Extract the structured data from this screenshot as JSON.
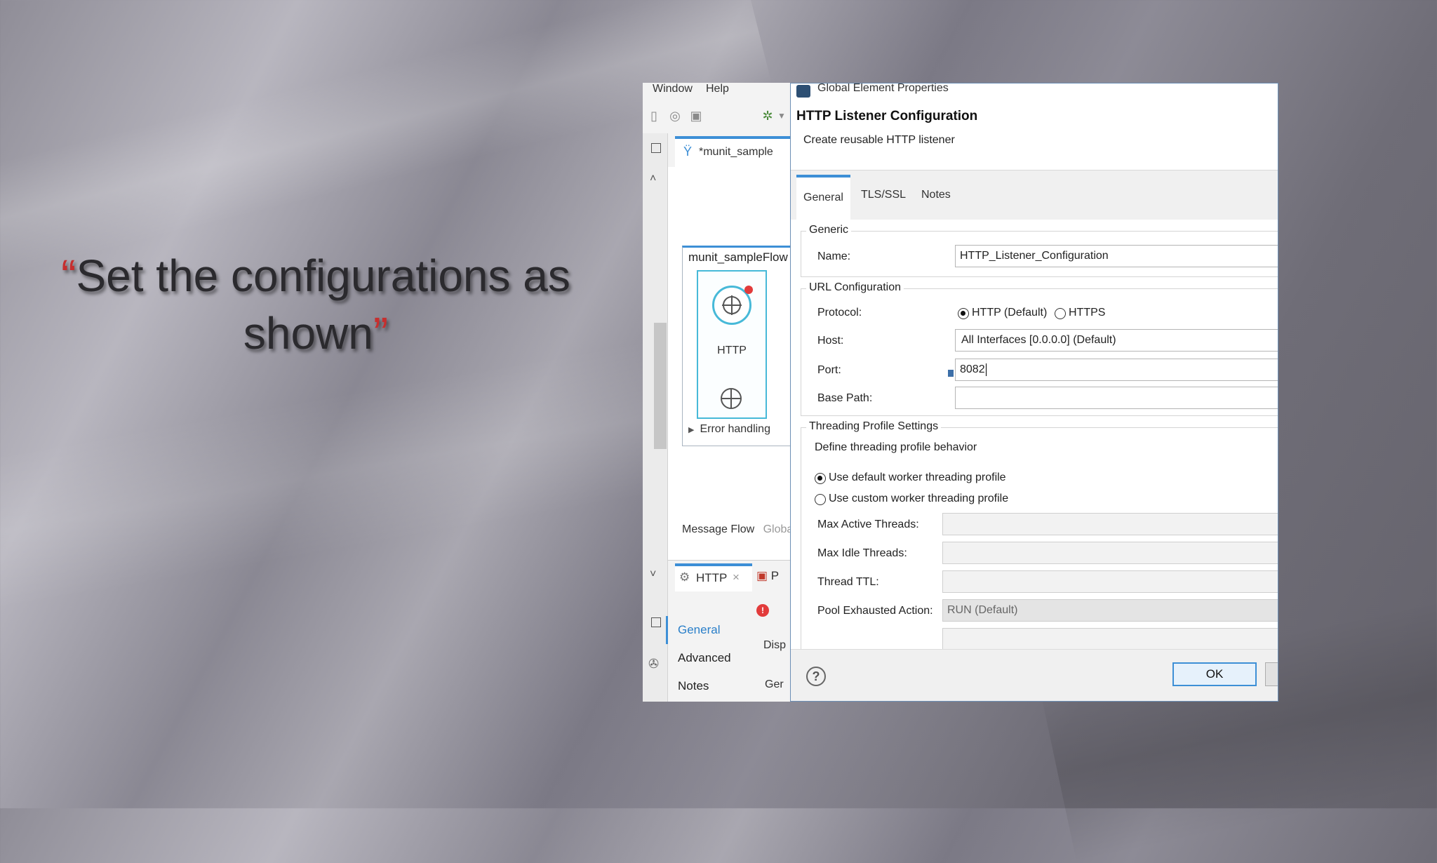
{
  "slide": {
    "open_quote": "“",
    "caption": "Set the configurations as shown",
    "close_quote": "”"
  },
  "studio": {
    "menu": [
      "Window",
      "Help"
    ],
    "editor_tab": "*munit_sample",
    "flow_title": "munit_sampleFlow",
    "http_node_label": "HTTP",
    "error_handling": "Error handling",
    "bottom_tabs": [
      "Message Flow",
      "Globa"
    ],
    "props_tab": "HTTP",
    "props_tab_partial": "P",
    "side_nav": [
      "General",
      "Advanced",
      "Notes"
    ],
    "partial_text": [
      "Disp",
      "Ger"
    ]
  },
  "dialog": {
    "window_title": "Global Element Properties",
    "heading": "HTTP Listener Configuration",
    "subheading": "Create reusable HTTP listener",
    "tabs": [
      "General",
      "TLS/SSL",
      "Notes"
    ],
    "active_tab": "General",
    "generic": {
      "legend": "Generic",
      "name_label": "Name:",
      "name_value": "HTTP_Listener_Configuration"
    },
    "url_config": {
      "legend": "URL Configuration",
      "protocol_label": "Protocol:",
      "protocol_options": [
        "HTTP (Default)",
        "HTTPS"
      ],
      "protocol_selected": "HTTP (Default)",
      "host_label": "Host:",
      "host_value": "All Interfaces [0.0.0.0] (Default)",
      "port_label": "Port:",
      "port_value": "8082",
      "base_path_label": "Base Path:",
      "base_path_value": ""
    },
    "threading": {
      "legend": "Threading Profile Settings",
      "description": "Define threading profile behavior",
      "option_default": "Use default worker threading profile",
      "option_custom": "Use custom worker threading profile",
      "selected": "Use default worker threading profile",
      "max_active_label": "Max Active Threads:",
      "max_idle_label": "Max Idle Threads:",
      "ttl_label": "Thread TTL:",
      "pool_exhausted_label": "Pool Exhausted Action:",
      "pool_exhausted_value": "RUN (Default)"
    },
    "footer": {
      "help": "?",
      "ok": "OK"
    }
  },
  "colors": {
    "accent": "#3d8fd6",
    "quote_red": "#c62f2f",
    "node_border": "#47b9d8"
  }
}
